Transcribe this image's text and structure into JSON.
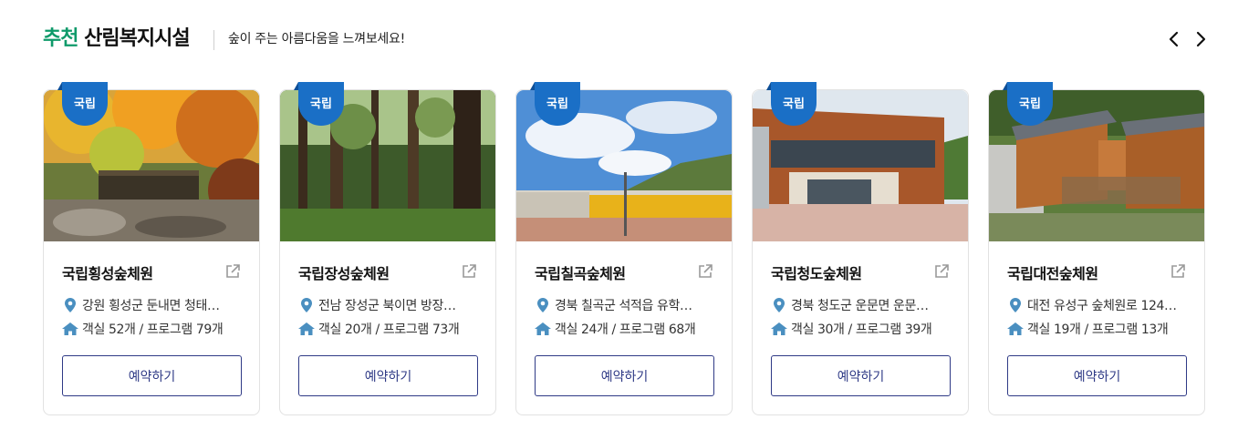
{
  "section": {
    "title_accent": "추천",
    "title_main": "산림복지시설",
    "subtitle": "숲이 주는 아름다움을 느껴보세요!"
  },
  "colors": {
    "accent_green": "#0f9a6a",
    "badge_blue": "#1a6fc6",
    "button_navy": "#2f3a86",
    "icon_teal": "#4a8fc0"
  },
  "cards": [
    {
      "badge": "국립",
      "name": "국립횡성숲체원",
      "address": "강원 횡성군 둔내면 청태…",
      "rooms": "객실 52개 / 프로그램 79개",
      "button": "예약하기"
    },
    {
      "badge": "국립",
      "name": "국립장성숲체원",
      "address": "전남 장성군 북이면 방장…",
      "rooms": "객실 20개 / 프로그램 73개",
      "button": "예약하기"
    },
    {
      "badge": "국립",
      "name": "국립칠곡숲체원",
      "address": "경북 칠곡군 석적읍 유학…",
      "rooms": "객실 24개 / 프로그램 68개",
      "button": "예약하기"
    },
    {
      "badge": "국립",
      "name": "국립청도숲체원",
      "address": "경북 청도군 운문면 운문…",
      "rooms": "객실 30개 / 프로그램 39개",
      "button": "예약하기"
    },
    {
      "badge": "국립",
      "name": "국립대전숲체원",
      "address": "대전 유성구 숲체원로 124…",
      "rooms": "객실 19개 / 프로그램 13개",
      "button": "예약하기"
    }
  ]
}
